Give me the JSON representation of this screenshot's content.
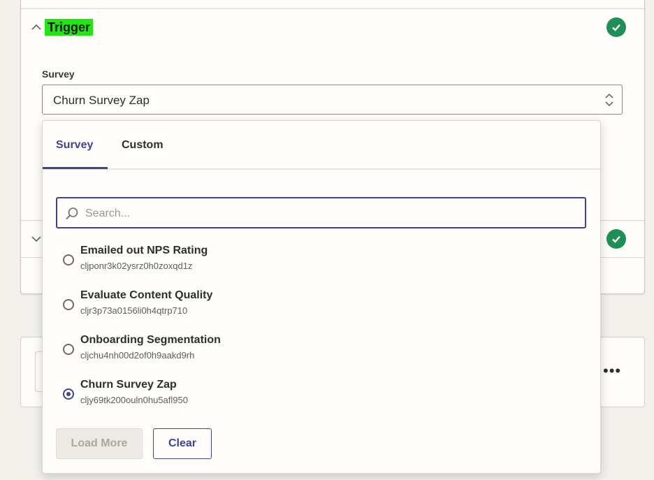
{
  "trigger": {
    "title": "Trigger",
    "survey_label": "Survey",
    "selected_value": "Churn Survey Zap"
  },
  "dropdown": {
    "tabs": [
      {
        "label": "Survey",
        "active": true
      },
      {
        "label": "Custom",
        "active": false
      }
    ],
    "search": {
      "placeholder": "Search...",
      "value": ""
    },
    "options": [
      {
        "name": "Emailed out NPS Rating",
        "id": "cljponr3k02ysrz0h0zoxqd1z",
        "selected": false
      },
      {
        "name": "Evaluate Content Quality",
        "id": "cljr3p73a0156li0h4qtrp710",
        "selected": false
      },
      {
        "name": "Onboarding Segmentation",
        "id": "cljchu4nh00d2of0h9aakd9rh",
        "selected": false
      },
      {
        "name": "Churn Survey Zap",
        "id": "cljy69tk200ouln0hu5afl950",
        "selected": true
      }
    ],
    "load_more_label": "Load More",
    "clear_label": "Clear"
  },
  "more_menu_glyph": "•••",
  "colors": {
    "accent": "#3d4592",
    "success": "#1f8f56",
    "highlight": "#22e514",
    "background": "#f3f1ec",
    "surface": "#fffdf9"
  },
  "icons": [
    "chevron-up-icon",
    "chevron-down-icon",
    "check-circle-icon",
    "sort-arrows-icon",
    "search-icon",
    "radio-icon",
    "more-dots-icon"
  ]
}
